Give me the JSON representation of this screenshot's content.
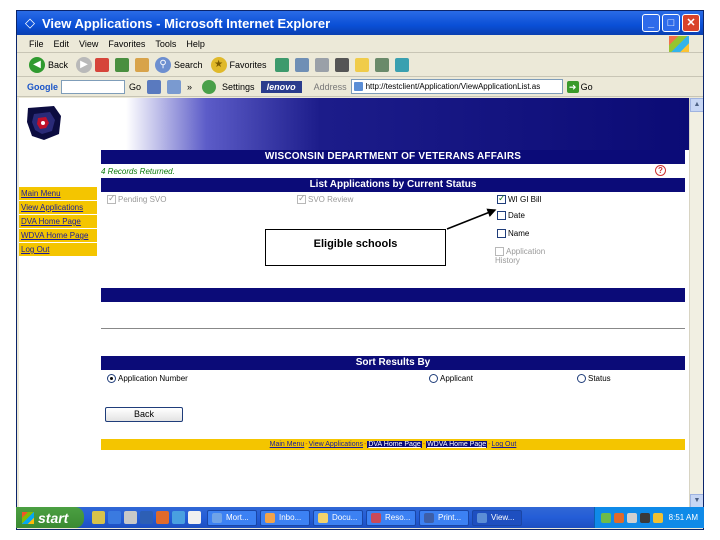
{
  "window": {
    "title": "View Applications - Microsoft Internet Explorer"
  },
  "menu": [
    "File",
    "Edit",
    "View",
    "Favorites",
    "Tools",
    "Help"
  ],
  "toolbar": {
    "back": "Back",
    "search": "Search",
    "favorites": "Favorites"
  },
  "google_bar": {
    "brand": "Google",
    "go_label": "Go",
    "settings_label": "Settings",
    "lenovo": "lenovo",
    "more": "»"
  },
  "address": {
    "label": "Address",
    "url": "http://testclient/Application/ViewApplicationList.as",
    "go": "Go"
  },
  "page": {
    "header_title": "WISCONSIN DEPARTMENT OF VETERANS AFFAIRS",
    "records_text": "4 Records Returned.",
    "help_symbol": "?",
    "sidebar": [
      "Main Menu",
      "View Applications",
      "DVA Home Page",
      "WDVA Home Page",
      "Log Out"
    ],
    "list_header": "List Applications by Current Status",
    "status_options": [
      {
        "label": "Pending SVO",
        "checked": true,
        "disabled": true
      },
      {
        "label": "SVO Review",
        "checked": true,
        "disabled": true
      },
      {
        "label": "WI GI Bill",
        "checked": true,
        "disabled": false
      }
    ],
    "filter_options": [
      {
        "label": "Date",
        "checked": false,
        "disabled": false
      },
      {
        "label": "Name",
        "checked": false,
        "disabled": false
      },
      {
        "label": "Application History",
        "checked": false,
        "disabled": true
      }
    ],
    "callout_text": "Eligible schools",
    "sort_header": "Sort Results By",
    "sort_options": [
      {
        "label": "Application Number",
        "selected": true
      },
      {
        "label": "Applicant",
        "selected": false
      },
      {
        "label": "Status",
        "selected": false
      }
    ],
    "back_button": "Back",
    "footer_links": [
      "Main Menu",
      "View Applications",
      "DVA Home Page",
      "WDVA Home Page",
      "Log Out"
    ],
    "footer_separator": "-"
  },
  "taskbar": {
    "start": "start",
    "tasks": [
      "Mort...",
      "Inbo...",
      "Docu...",
      "Reso...",
      "Print...",
      "View..."
    ],
    "clock": "8:51 AM"
  }
}
